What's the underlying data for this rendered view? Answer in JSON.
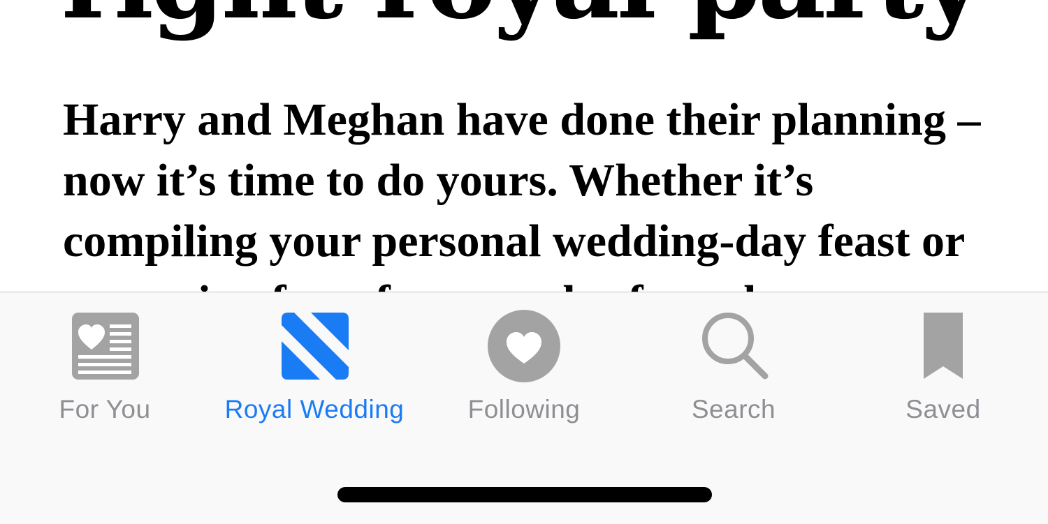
{
  "article": {
    "headline": "right royal party",
    "dek": "Harry and Meghan have done their planning – now it’s time to do yours. Whether it’s compiling your personal wedding-day feast or preparing for a few rounds of royal"
  },
  "tabbar": {
    "items": [
      {
        "label": "For You",
        "icon": "news-today-icon",
        "active": false
      },
      {
        "label": "Royal Wedding",
        "icon": "apple-news-icon",
        "active": true
      },
      {
        "label": "Following",
        "icon": "heart-circle-icon",
        "active": false
      },
      {
        "label": "Search",
        "icon": "search-icon",
        "active": false
      },
      {
        "label": "Saved",
        "icon": "bookmark-icon",
        "active": false
      }
    ]
  },
  "colors": {
    "accent": "#1a7cf5",
    "inactive": "#8e8e93",
    "icon_inactive": "#a3a3a3",
    "text": "#000000"
  }
}
